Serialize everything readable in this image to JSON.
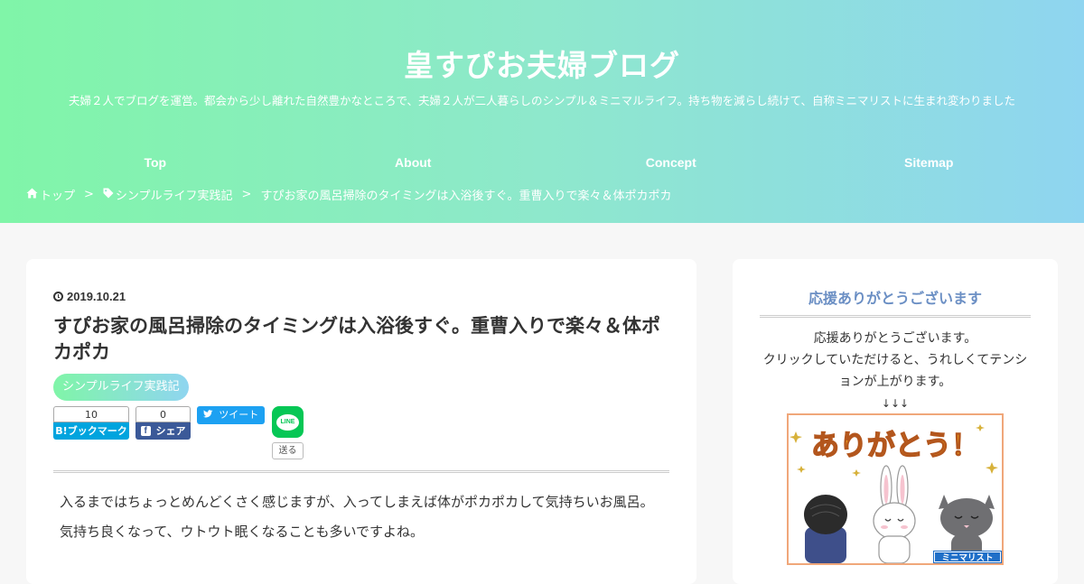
{
  "site": {
    "title": "皇すぴお夫婦ブログ",
    "tagline": "夫婦２人でブログを運営。都会から少し離れた自然豊かなところで、夫婦２人が二人暮らしのシンプル＆ミニマルライフ。持ち物を減らし続けて、自称ミニマリストに生まれ変わりました"
  },
  "nav": [
    "Top",
    "About",
    "Concept",
    "Sitemap"
  ],
  "breadcrumb": {
    "home": "トップ",
    "sep": ">",
    "category": "シンプルライフ実践記",
    "current": "すぴお家の風呂掃除のタイミングは入浴後すぐ。重曹入りで楽々＆体ポカポカ"
  },
  "post": {
    "date": "2019.10.21",
    "title": "すぴお家の風呂掃除のタイミングは入浴後すぐ。重曹入りで楽々＆体ポカポカ",
    "category": "シンプルライフ実践記",
    "paragraphs": [
      "入るまではちょっとめんどくさく感じますが、入ってしまえば体がポカポカして気持ちいお風呂。",
      "気持ち良くなって、ウトウト眠くなることも多いですよね。"
    ]
  },
  "share": {
    "hatena": {
      "count": "10",
      "label": "B!ブックマーク"
    },
    "facebook": {
      "count": "0",
      "label": "シェア"
    },
    "tweet": {
      "label": "ツイート"
    },
    "line": {
      "icon_text": "LINE",
      "label": "送る"
    }
  },
  "sidebar": {
    "widget_title": "応援ありがとうございます",
    "lines": [
      "応援ありがとうございます。",
      "クリックしていただけると、うれしくてテンシ",
      "ョンが上がります。",
      "↓↓↓"
    ],
    "banner_text": "ありがとう！",
    "banner_label": "ミニマリスト"
  },
  "colors": {
    "gradient_start": "#80f5a8",
    "gradient_end": "#8fd5f0",
    "hatena": "#00a4de",
    "facebook": "#3b5998",
    "twitter": "#1da1f2",
    "line": "#06c755",
    "widget_title": "#6b8fc4"
  }
}
